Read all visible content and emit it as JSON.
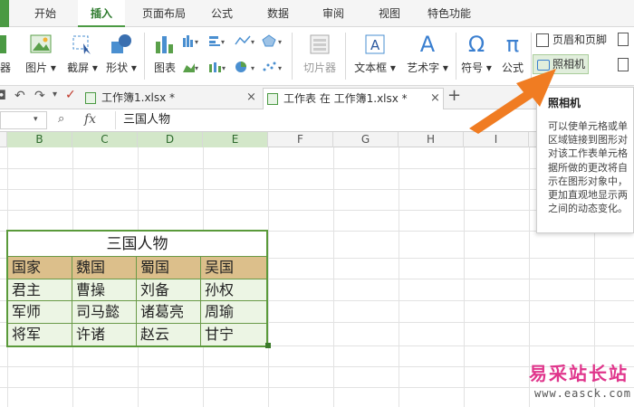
{
  "menu": {
    "tabs": [
      "开始",
      "插入",
      "页面布局",
      "公式",
      "数据",
      "审阅",
      "视图",
      "特色功能"
    ],
    "active_index": 1
  },
  "ribbon": {
    "partial_left": "器",
    "picture": "图片",
    "screenshot": "截屏",
    "shapes": "形状",
    "chart": "图表",
    "slicer": "切片器",
    "textbox": "文本框",
    "wordart": "艺术字",
    "symbol": "符号",
    "formula": "公式",
    "header_footer": "页眉和页脚",
    "camera": "照相机",
    "symbol_glyph": "Ω",
    "formula_glyph": "π",
    "wordart_glyph": "A"
  },
  "doc_tabs": [
    {
      "title": "工作簿1.xlsx *",
      "active": false
    },
    {
      "title": "工作表 在 工作簿1.xlsx *",
      "active": true
    }
  ],
  "formula_bar": {
    "fx": "fx",
    "content": "三国人物"
  },
  "columns": [
    "B",
    "C",
    "D",
    "E",
    "F",
    "G",
    "H",
    "I"
  ],
  "table": {
    "title": "三国人物",
    "header": [
      "国家",
      "魏国",
      "蜀国",
      "吴国"
    ],
    "rows": [
      [
        "君主",
        "曹操",
        "刘备",
        "孙权"
      ],
      [
        "军师",
        "司马懿",
        "诸葛亮",
        "周瑜"
      ],
      [
        "将军",
        "许诸",
        "赵云",
        "甘宁"
      ]
    ]
  },
  "tooltip": {
    "title": "照相机",
    "body": "可以使单元格或单\n区域链接到图形对\n对该工作表单元格\n据所做的更改将自\n示在图形对象中，\n更加直观地显示两\n之间的动态变化。"
  },
  "watermark": {
    "name": "易采站长站",
    "url": "www.easck.com"
  },
  "colors": {
    "accent": "#4b9a43",
    "table_header": "#dcbf8b",
    "table_cell": "#ecf5e4",
    "arrow": "#f07c22",
    "watermark": "#e0368c"
  }
}
